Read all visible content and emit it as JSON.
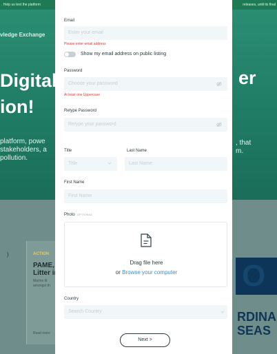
{
  "background": {
    "topbar_left": ". Help us test the platform",
    "topbar_right": "releases, until its final",
    "brand": "vledge Exchange",
    "hero_title_line1": "Digital",
    "hero_title_line2": "ion!",
    "hero_title_right": "er",
    "hero_desc_line1": "platform, powe",
    "hero_desc_line2": "stakeholders, a",
    "hero_desc_line3": "pollution.",
    "hero_desc_right_line1": ", that",
    "hero_desc_right_line2": "m.",
    "card_paren": ")",
    "card_action": "ACTION",
    "card_title_line1": "PAME,",
    "card_title_line2": "Litter in",
    "card_text_line1": "Marine lit",
    "card_text_line2": "amongst th",
    "card_read_more": "Read more",
    "logo_text": "O",
    "logo_line1": "RDINA",
    "logo_line2": "SEAS"
  },
  "form": {
    "email_label": "Email",
    "email_placeholder": "Enter your email",
    "email_error": "Please enter email address",
    "public_listing_label": "Show my email address on public listing",
    "password_label": "Password",
    "password_placeholder": "Choose your password",
    "password_error": "At least one Uppercase",
    "retype_label": "Retype Password",
    "retype_placeholder": "Retype your password",
    "title_label": "Title",
    "title_placeholder": "Title",
    "last_name_label": "Last Name",
    "last_name_placeholder": "Last Name",
    "first_name_label": "First Name",
    "first_name_placeholder": "First Name",
    "photo_label": "Photo",
    "photo_optional": "OPTIONAL",
    "drop_title": "Drag file here",
    "drop_or": "or",
    "drop_link": "Browse your computer",
    "country_label": "Country",
    "country_placeholder": "Search Country",
    "next_label": "Next >"
  },
  "icons": {
    "password_toggle": "eye-off-icon",
    "retype_toggle": "eye-off-icon",
    "title_dropdown": "chevron-down-icon",
    "country_dropdown": "chevron-down-icon",
    "file_upload": "file-icon"
  },
  "colors": {
    "error": "#d33a3a",
    "link": "#3b8bc8",
    "input_bg": "#f1f6f9",
    "hero_green": "#1f7a63",
    "topbar_green": "#1d7a52"
  }
}
